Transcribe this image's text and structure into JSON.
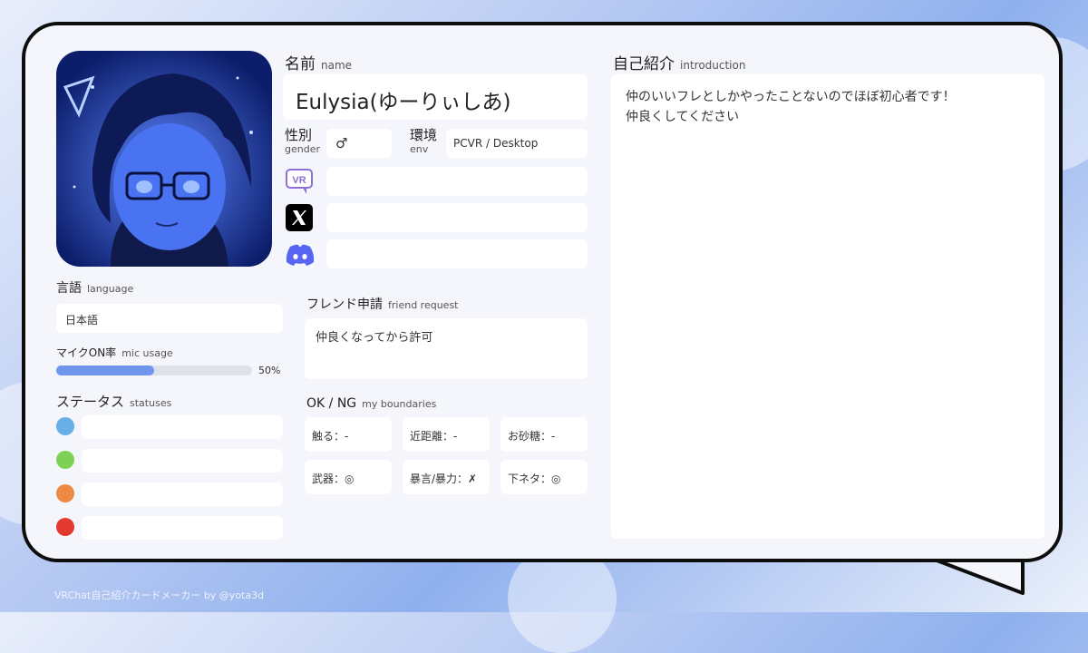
{
  "name": {
    "label_jp": "名前",
    "label_en": "name",
    "value": "Eulysia(ゆーりぃしあ)"
  },
  "gender": {
    "label_jp": "性別",
    "label_en": "gender",
    "value": "♂"
  },
  "env": {
    "label_jp": "環境",
    "label_en": "env",
    "value": "PCVR / Desktop"
  },
  "social": [
    {
      "icon": "vrchat-icon",
      "value": ""
    },
    {
      "icon": "x-twitter-icon",
      "value": ""
    },
    {
      "icon": "discord-icon",
      "value": ""
    }
  ],
  "language": {
    "label_jp": "言語",
    "label_en": "language",
    "value": "日本語"
  },
  "mic": {
    "label_jp": "マイクON率",
    "label_en": "mic usage",
    "percent_text": "50%",
    "fraction": 0.5
  },
  "statuses": {
    "label_jp": "ステータス",
    "label_en": "statuses",
    "items": [
      {
        "color": "#6aaee8",
        "text": ""
      },
      {
        "color": "#7dd256",
        "text": ""
      },
      {
        "color": "#ee8a44",
        "text": ""
      },
      {
        "color": "#e23a2e",
        "text": ""
      }
    ]
  },
  "friend_request": {
    "label_jp": "フレンド申請",
    "label_en": "friend request",
    "value": "仲良くなってから許可"
  },
  "boundaries": {
    "label_jp": "OK / NG",
    "label_en": "my boundaries",
    "items": [
      "触る：-",
      "近距離：-",
      "お砂糖：-",
      "武器：◎",
      "暴言/暴力：✗",
      "下ネタ：◎"
    ]
  },
  "intro": {
    "label_jp": "自己紹介",
    "label_en": "introduction",
    "lines": [
      "仲のいいフレとしかやったことないのでほぼ初心者です！",
      "仲良くしてください"
    ]
  },
  "footer": "VRChat自己紹介カードメーカー by @yota3d",
  "colors": {
    "border": "#0d0d0d",
    "mic_bar": "#6f95ec",
    "card": "#f4f6fb"
  }
}
